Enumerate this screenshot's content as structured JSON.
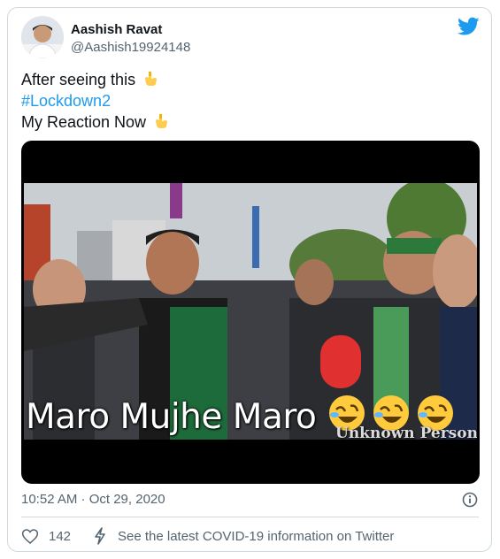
{
  "tweet": {
    "author_name": "Aashish Ravat",
    "author_handle": "@Aashish19924148",
    "lines": [
      "After seeing this",
      "#Lockdown2",
      "My Reaction Now"
    ],
    "timestamp": "10:52 AM · Oct 29, 2020",
    "like_count": "142",
    "covid_link": "See the latest COVID-19 information on Twitter"
  },
  "media": {
    "caption": "Maro Mujhe Maro",
    "watermark": "Unknown Person",
    "emoji_in_caption": [
      "rolling-on-floor-laughing",
      "rolling-on-floor-laughing",
      "rolling-on-floor-laughing"
    ]
  },
  "icons": [
    "twitter-bird-icon",
    "backhand-index-pointing-down-icon",
    "info-icon",
    "heart-icon",
    "lightning-bolt-icon"
  ],
  "colors": {
    "link": "#1d9bf0",
    "brand": "#1d9bf0",
    "secondary_text": "#536471",
    "border": "#cfd9de"
  }
}
